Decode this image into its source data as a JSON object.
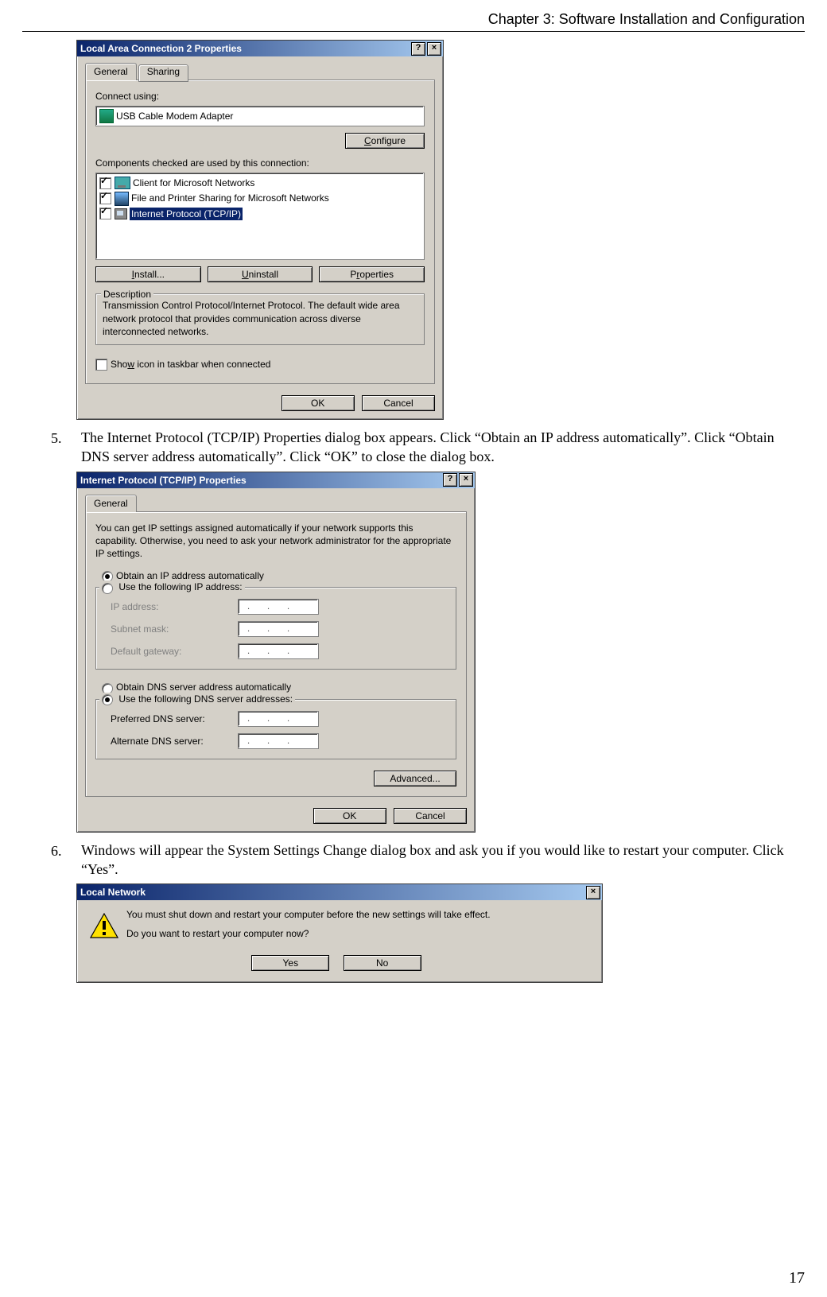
{
  "header": {
    "title": "Chapter 3: Software Installation and Configuration"
  },
  "page_number": "17",
  "steps": {
    "n5": "5.",
    "t5": "The Internet Protocol (TCP/IP) Properties dialog box appears. Click “Obtain an IP address automatically”. Click “Obtain DNS server address automatically”. Click “OK” to close the dialog box.",
    "n6": "6.",
    "t6": "Windows will appear the System Settings Change dialog box and ask you if you would like to restart your computer. Click “Yes”."
  },
  "dlg1": {
    "title": "Local Area Connection 2 Properties",
    "tabs": {
      "general": "General",
      "sharing": "Sharing"
    },
    "connect_using_label": "Connect using:",
    "adapter": "USB Cable Modem Adapter",
    "configure": "Configure",
    "components_label": "Components checked are used by this connection:",
    "items": {
      "client": "Client for Microsoft Networks",
      "fps": "File and Printer Sharing for Microsoft Networks",
      "tcpip": "Internet Protocol (TCP/IP)"
    },
    "install": "Install...",
    "uninstall": "Uninstall",
    "properties": "Properties",
    "desc_label": "Description",
    "desc_text": "Transmission Control Protocol/Internet Protocol. The default wide area network protocol that provides communication across diverse interconnected networks.",
    "show_icon": "Show icon in taskbar when connected",
    "ok": "OK",
    "cancel": "Cancel",
    "help": "?",
    "close": "×"
  },
  "dlg2": {
    "title": "Internet Protocol (TCP/IP) Properties",
    "tab_general": "General",
    "intro": "You can get IP settings assigned automatically if your network supports this capability. Otherwise, you need to ask your network administrator for the appropriate IP settings.",
    "r_obtain_ip": "Obtain an IP address automatically",
    "r_use_ip": "Use the following IP address:",
    "ip_label": "IP address:",
    "subnet_label": "Subnet mask:",
    "gateway_label": "Default gateway:",
    "r_obtain_dns": "Obtain DNS server address automatically",
    "r_use_dns": "Use the following DNS server addresses:",
    "pref_dns": "Preferred DNS server:",
    "alt_dns": "Alternate DNS server:",
    "advanced": "Advanced...",
    "ok": "OK",
    "cancel": "Cancel",
    "help": "?",
    "close": "×"
  },
  "dlg3": {
    "title": "Local Network",
    "line1": "You must shut down and restart your computer before the new settings will take effect.",
    "line2": "Do you want to restart your computer now?",
    "yes": "Yes",
    "no": "No",
    "close": "×"
  }
}
